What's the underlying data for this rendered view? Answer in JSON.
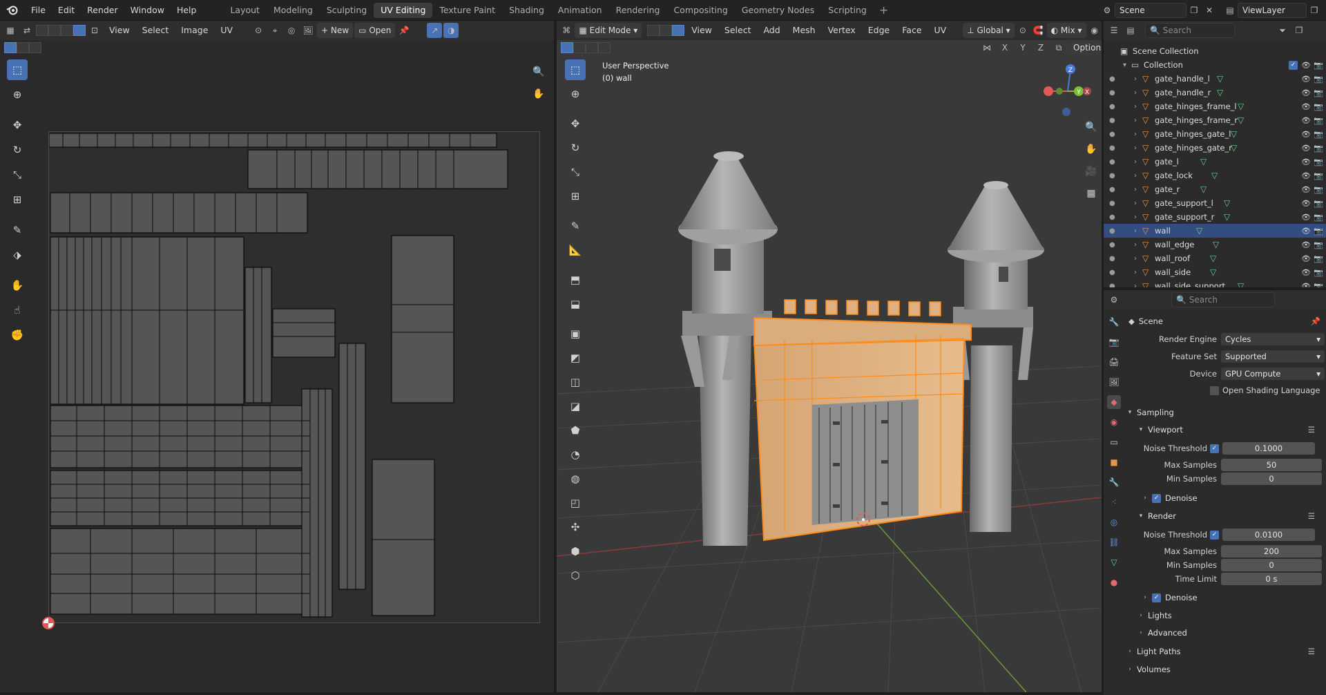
{
  "topbar": {
    "menus": [
      "File",
      "Edit",
      "Render",
      "Window",
      "Help"
    ],
    "workspaces": [
      "Layout",
      "Modeling",
      "Sculpting",
      "UV Editing",
      "Texture Paint",
      "Shading",
      "Animation",
      "Rendering",
      "Compositing",
      "Geometry Nodes",
      "Scripting"
    ],
    "active_workspace": "UV Editing",
    "scene_name": "Scene",
    "view_layer": "ViewLayer"
  },
  "uv_editor": {
    "menus": [
      "View",
      "Select",
      "Image",
      "UV"
    ],
    "new_label": "New",
    "open_label": "Open"
  },
  "viewport": {
    "mode": "Edit Mode",
    "menus": [
      "View",
      "Select",
      "Add",
      "Mesh",
      "Vertex",
      "Edge",
      "Face",
      "UV"
    ],
    "orientation": "Global",
    "shading": "Mix",
    "options_label": "Options",
    "axis_locks": [
      "X",
      "Y",
      "Z"
    ],
    "overlay_title": "User Perspective",
    "overlay_object": "(0) wall",
    "gizmo_labels": {
      "z": "Z",
      "y": "Y",
      "x": "X"
    }
  },
  "outliner": {
    "search_placeholder": "Search",
    "scene_collection": "Scene Collection",
    "collection": "Collection",
    "items": [
      {
        "name": "gate_handle_l"
      },
      {
        "name": "gate_handle_r"
      },
      {
        "name": "gate_hinges_frame_l"
      },
      {
        "name": "gate_hinges_frame_r"
      },
      {
        "name": "gate_hinges_gate_l"
      },
      {
        "name": "gate_hinges_gate_r"
      },
      {
        "name": "gate_l"
      },
      {
        "name": "gate_lock"
      },
      {
        "name": "gate_r"
      },
      {
        "name": "gate_support_l"
      },
      {
        "name": "gate_support_r"
      },
      {
        "name": "wall"
      },
      {
        "name": "wall_edge"
      },
      {
        "name": "wall_roof"
      },
      {
        "name": "wall_side"
      },
      {
        "name": "wall_side_support"
      }
    ],
    "selected_item": "wall"
  },
  "properties": {
    "search_placeholder": "Search",
    "context_title": "Scene",
    "render_engine_label": "Render Engine",
    "render_engine": "Cycles",
    "feature_set_label": "Feature Set",
    "feature_set": "Supported",
    "device_label": "Device",
    "device": "GPU Compute",
    "osl_label": "Open Shading Language",
    "sampling_label": "Sampling",
    "viewport_label": "Viewport",
    "noise_threshold_label": "Noise Threshold",
    "viewport_noise_threshold": "0.1000",
    "max_samples_label": "Max Samples",
    "viewport_max_samples": "50",
    "min_samples_label": "Min Samples",
    "viewport_min_samples": "0",
    "denoise_label": "Denoise",
    "render_label": "Render",
    "render_noise_threshold": "0.0100",
    "render_max_samples": "200",
    "render_min_samples": "0",
    "time_limit_label": "Time Limit",
    "time_limit": "0 s",
    "lights_label": "Lights",
    "advanced_label": "Advanced",
    "light_paths_label": "Light Paths",
    "volumes_label": "Volumes"
  },
  "colors": {
    "accent": "#4772b3",
    "selection_orange": "#ff8c1a",
    "mesh_icon": "#e8954a",
    "data_icon": "#6fcf8a"
  }
}
